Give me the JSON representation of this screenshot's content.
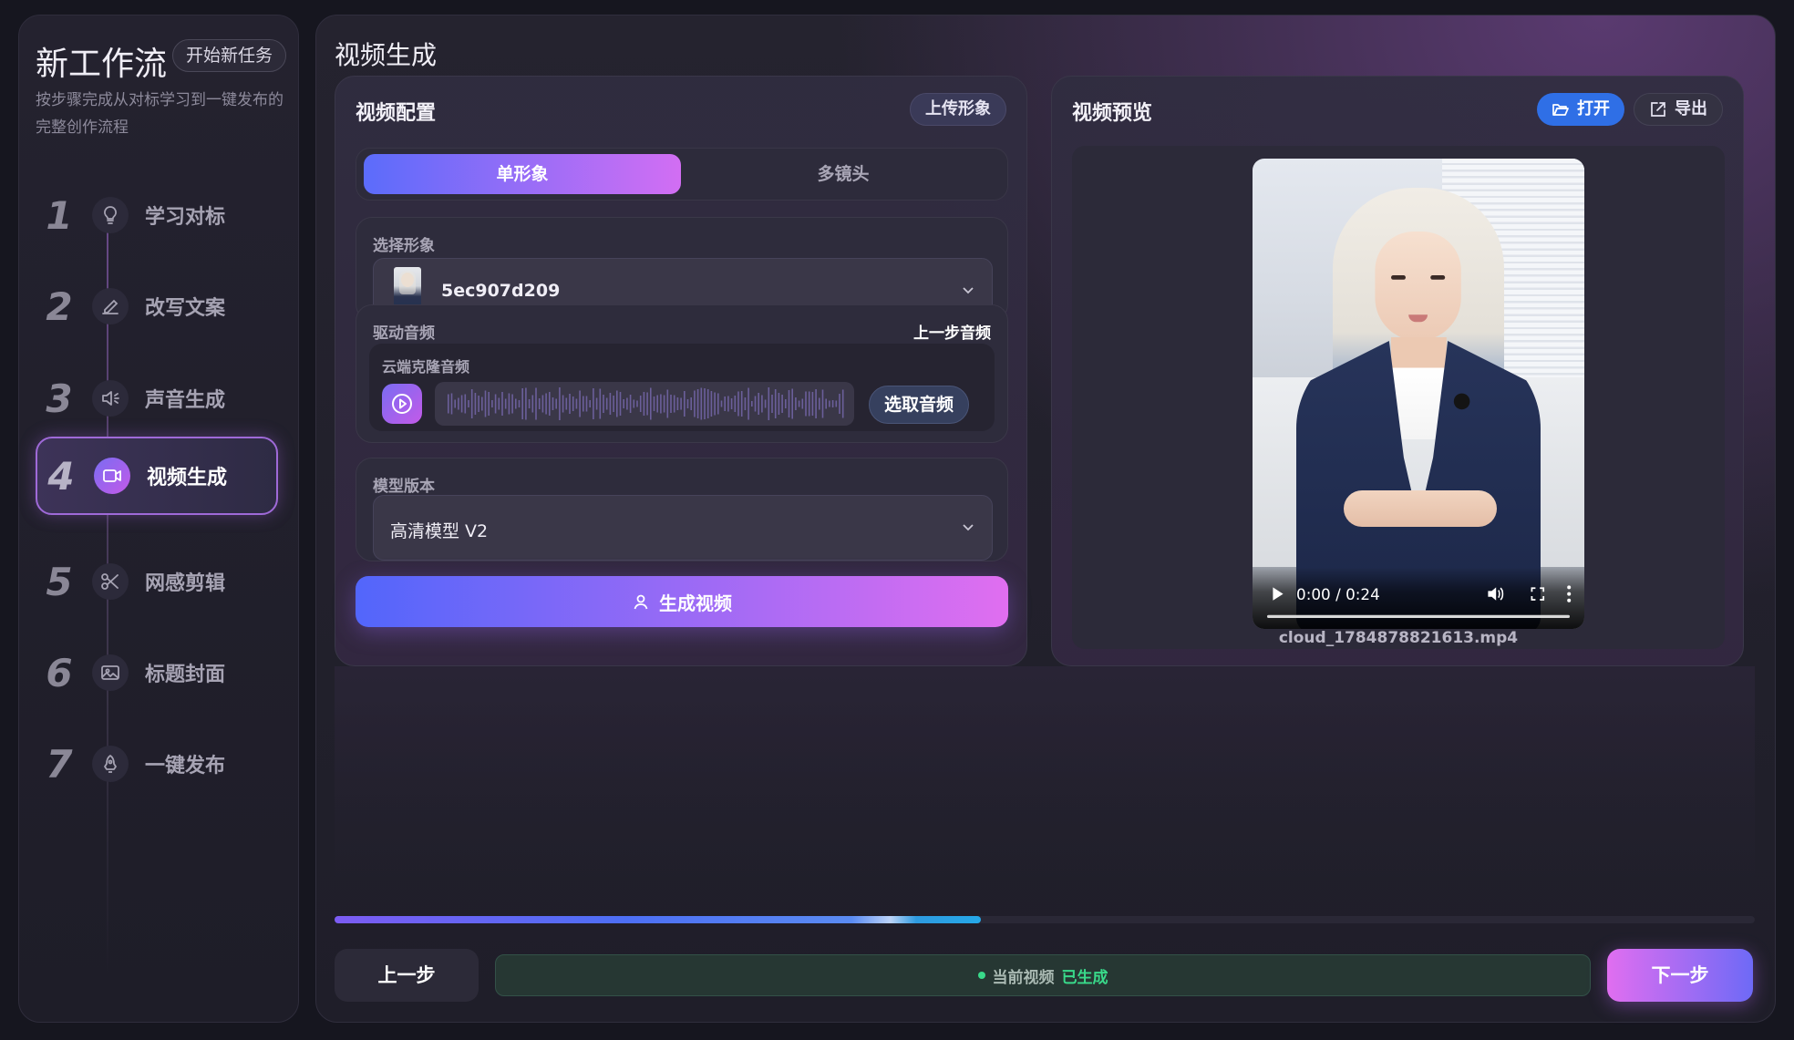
{
  "sidebar": {
    "title": "新工作流",
    "badge": "开始新任务",
    "description": "按步骤完成从对标学习到一键发布的完整创作流程",
    "steps": [
      {
        "num": "1",
        "label": "学习对标",
        "icon": "lightbulb-icon"
      },
      {
        "num": "2",
        "label": "改写文案",
        "icon": "pencil-icon"
      },
      {
        "num": "3",
        "label": "声音生成",
        "icon": "speaker-icon"
      },
      {
        "num": "4",
        "label": "视频生成",
        "icon": "video-camera-icon"
      },
      {
        "num": "5",
        "label": "网感剪辑",
        "icon": "scissors-icon"
      },
      {
        "num": "6",
        "label": "标题封面",
        "icon": "image-icon"
      },
      {
        "num": "7",
        "label": "一键发布",
        "icon": "rocket-icon"
      }
    ],
    "active_step": 4
  },
  "main": {
    "title": "视频生成",
    "config": {
      "title": "视频配置",
      "upload_label": "上传形象",
      "tabs": [
        "单形象",
        "多镜头"
      ],
      "active_tab": "单形象",
      "avatar_section": {
        "label": "选择形象",
        "selected": "5ec907d209"
      },
      "audio_section": {
        "label": "驱动音频",
        "prev_step_label": "上一步音频",
        "source_label": "云端克隆音频",
        "pick_label": "选取音频"
      },
      "model_section": {
        "label": "模型版本",
        "selected": "高清模型 V2"
      },
      "generate_label": "生成视频"
    },
    "preview": {
      "title": "视频预览",
      "open_label": "打开",
      "export_label": "导出",
      "time_display": "0:00 / 0:24",
      "filename": "cloud_1784878821613.mp4"
    }
  },
  "footer": {
    "progress": 0.455,
    "prev_label": "上一步",
    "status_prefix": "当前视频",
    "status_value": "已生成",
    "next_label": "下一步"
  },
  "colors": {
    "accent_start": "#5b6cfb",
    "accent_end": "#e06ef0",
    "active_border": "#9f6ad8",
    "status_green": "#39d98a"
  }
}
